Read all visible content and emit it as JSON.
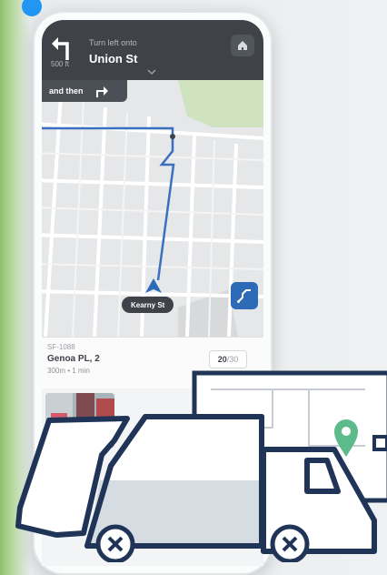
{
  "nav": {
    "distance": "500 ft",
    "turn_hint": "Turn left onto",
    "street": "Union St",
    "next_label": "and then"
  },
  "map": {
    "location_label": "Kearny St"
  },
  "stop": {
    "id": "SF-1088",
    "name": "Genoa PL, 2",
    "meta": "300m • 1 min",
    "count_current": "20",
    "count_sep": "/",
    "count_total": "30"
  },
  "icons": {
    "turn": "turn-left-icon",
    "home": "home-icon",
    "next_turn": "turn-right-icon",
    "location": "navigation-arrow-icon",
    "route": "route-icon",
    "pin": "map-pin-icon",
    "collapse": "chevron-down-icon"
  },
  "colors": {
    "header": "#3f4249",
    "route": "#3b6fbf",
    "truck_outline": "#1f3457",
    "pin": "#5dba8b",
    "accent_dot": "#2196f3"
  }
}
